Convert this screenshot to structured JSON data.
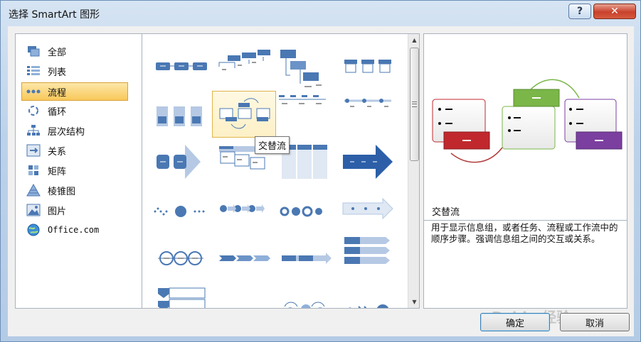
{
  "window": {
    "title": "选择 SmartArt 图形",
    "help_label": "?",
    "close_label": "✕"
  },
  "categories": [
    {
      "label": "全部",
      "icon": "all-icon"
    },
    {
      "label": "列表",
      "icon": "list-icon"
    },
    {
      "label": "流程",
      "icon": "process-icon",
      "selected": true
    },
    {
      "label": "循环",
      "icon": "cycle-icon"
    },
    {
      "label": "层次结构",
      "icon": "hierarchy-icon"
    },
    {
      "label": "关系",
      "icon": "relationship-icon"
    },
    {
      "label": "矩阵",
      "icon": "matrix-icon"
    },
    {
      "label": "棱锥图",
      "icon": "pyramid-icon"
    },
    {
      "label": "图片",
      "icon": "picture-icon"
    },
    {
      "label": "Office.com",
      "icon": "office-globe-icon"
    }
  ],
  "gallery": {
    "selected_index": 5,
    "tooltip": "交替流"
  },
  "preview": {
    "name": "交替流",
    "description": "用于显示信息组，或者任务、流程或工作流中的顺序步骤。强调信息组之间的交互或关系。",
    "colors": {
      "red": "#c0282d",
      "green": "#7ab648",
      "purple": "#7b3fa0"
    }
  },
  "buttons": {
    "ok_label": "确定",
    "cancel_label": "取消"
  },
  "watermark": "Baidu 经验"
}
